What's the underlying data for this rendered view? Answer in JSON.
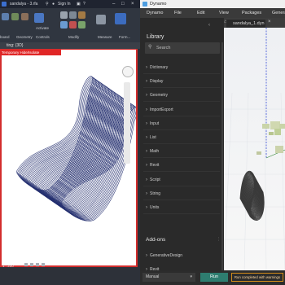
{
  "revit": {
    "title": "sandalya - 3.rfa",
    "sign_in": "Sign In",
    "ribbon": {
      "groups": [
        "board",
        "Geometry",
        "Controls",
        "Modify",
        "Measure",
        "Form..."
      ],
      "activate_label": "Activate"
    },
    "view_tab": "ting: {3D}",
    "banner": "Temporary Hide/Isolate",
    "status": {
      "scale": "1 : 200"
    }
  },
  "dynamo": {
    "title": "Dynamo",
    "menu": [
      "Dynamo",
      "File",
      "Edit",
      "View",
      "Packages",
      "Generate"
    ],
    "tab_name": "sandalya_1.dyn",
    "library": {
      "title": "Library",
      "search_placeholder": "Search",
      "items": [
        "Dictionary",
        "Display",
        "Geometry",
        "ImportExport",
        "Input",
        "List",
        "Math",
        "Revit",
        "Script",
        "String",
        "Units"
      ],
      "addons_title": "Add-ons",
      "addons": [
        "GenerativeDesign",
        "Revit"
      ]
    },
    "bottom": {
      "run_mode": "Manual",
      "run_label": "Run",
      "status": "Run completed with warnings"
    }
  },
  "colors": {
    "accent_red": "#d32d2d",
    "run_green": "#2e7d70",
    "warning_orange": "#d08a1a",
    "chair_line": "#253070"
  }
}
